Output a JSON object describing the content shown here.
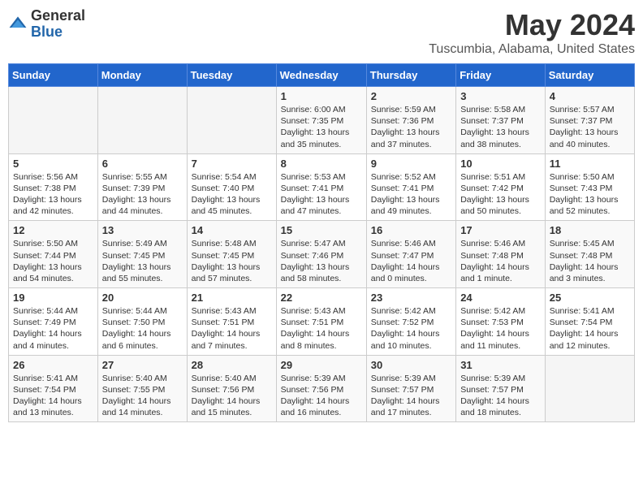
{
  "header": {
    "logo_general": "General",
    "logo_blue": "Blue",
    "month": "May 2024",
    "location": "Tuscumbia, Alabama, United States"
  },
  "weekdays": [
    "Sunday",
    "Monday",
    "Tuesday",
    "Wednesday",
    "Thursday",
    "Friday",
    "Saturday"
  ],
  "weeks": [
    [
      {
        "day": "",
        "detail": ""
      },
      {
        "day": "",
        "detail": ""
      },
      {
        "day": "",
        "detail": ""
      },
      {
        "day": "1",
        "detail": "Sunrise: 6:00 AM\nSunset: 7:35 PM\nDaylight: 13 hours\nand 35 minutes."
      },
      {
        "day": "2",
        "detail": "Sunrise: 5:59 AM\nSunset: 7:36 PM\nDaylight: 13 hours\nand 37 minutes."
      },
      {
        "day": "3",
        "detail": "Sunrise: 5:58 AM\nSunset: 7:37 PM\nDaylight: 13 hours\nand 38 minutes."
      },
      {
        "day": "4",
        "detail": "Sunrise: 5:57 AM\nSunset: 7:37 PM\nDaylight: 13 hours\nand 40 minutes."
      }
    ],
    [
      {
        "day": "5",
        "detail": "Sunrise: 5:56 AM\nSunset: 7:38 PM\nDaylight: 13 hours\nand 42 minutes."
      },
      {
        "day": "6",
        "detail": "Sunrise: 5:55 AM\nSunset: 7:39 PM\nDaylight: 13 hours\nand 44 minutes."
      },
      {
        "day": "7",
        "detail": "Sunrise: 5:54 AM\nSunset: 7:40 PM\nDaylight: 13 hours\nand 45 minutes."
      },
      {
        "day": "8",
        "detail": "Sunrise: 5:53 AM\nSunset: 7:41 PM\nDaylight: 13 hours\nand 47 minutes."
      },
      {
        "day": "9",
        "detail": "Sunrise: 5:52 AM\nSunset: 7:41 PM\nDaylight: 13 hours\nand 49 minutes."
      },
      {
        "day": "10",
        "detail": "Sunrise: 5:51 AM\nSunset: 7:42 PM\nDaylight: 13 hours\nand 50 minutes."
      },
      {
        "day": "11",
        "detail": "Sunrise: 5:50 AM\nSunset: 7:43 PM\nDaylight: 13 hours\nand 52 minutes."
      }
    ],
    [
      {
        "day": "12",
        "detail": "Sunrise: 5:50 AM\nSunset: 7:44 PM\nDaylight: 13 hours\nand 54 minutes."
      },
      {
        "day": "13",
        "detail": "Sunrise: 5:49 AM\nSunset: 7:45 PM\nDaylight: 13 hours\nand 55 minutes."
      },
      {
        "day": "14",
        "detail": "Sunrise: 5:48 AM\nSunset: 7:45 PM\nDaylight: 13 hours\nand 57 minutes."
      },
      {
        "day": "15",
        "detail": "Sunrise: 5:47 AM\nSunset: 7:46 PM\nDaylight: 13 hours\nand 58 minutes."
      },
      {
        "day": "16",
        "detail": "Sunrise: 5:46 AM\nSunset: 7:47 PM\nDaylight: 14 hours\nand 0 minutes."
      },
      {
        "day": "17",
        "detail": "Sunrise: 5:46 AM\nSunset: 7:48 PM\nDaylight: 14 hours\nand 1 minute."
      },
      {
        "day": "18",
        "detail": "Sunrise: 5:45 AM\nSunset: 7:48 PM\nDaylight: 14 hours\nand 3 minutes."
      }
    ],
    [
      {
        "day": "19",
        "detail": "Sunrise: 5:44 AM\nSunset: 7:49 PM\nDaylight: 14 hours\nand 4 minutes."
      },
      {
        "day": "20",
        "detail": "Sunrise: 5:44 AM\nSunset: 7:50 PM\nDaylight: 14 hours\nand 6 minutes."
      },
      {
        "day": "21",
        "detail": "Sunrise: 5:43 AM\nSunset: 7:51 PM\nDaylight: 14 hours\nand 7 minutes."
      },
      {
        "day": "22",
        "detail": "Sunrise: 5:43 AM\nSunset: 7:51 PM\nDaylight: 14 hours\nand 8 minutes."
      },
      {
        "day": "23",
        "detail": "Sunrise: 5:42 AM\nSunset: 7:52 PM\nDaylight: 14 hours\nand 10 minutes."
      },
      {
        "day": "24",
        "detail": "Sunrise: 5:42 AM\nSunset: 7:53 PM\nDaylight: 14 hours\nand 11 minutes."
      },
      {
        "day": "25",
        "detail": "Sunrise: 5:41 AM\nSunset: 7:54 PM\nDaylight: 14 hours\nand 12 minutes."
      }
    ],
    [
      {
        "day": "26",
        "detail": "Sunrise: 5:41 AM\nSunset: 7:54 PM\nDaylight: 14 hours\nand 13 minutes."
      },
      {
        "day": "27",
        "detail": "Sunrise: 5:40 AM\nSunset: 7:55 PM\nDaylight: 14 hours\nand 14 minutes."
      },
      {
        "day": "28",
        "detail": "Sunrise: 5:40 AM\nSunset: 7:56 PM\nDaylight: 14 hours\nand 15 minutes."
      },
      {
        "day": "29",
        "detail": "Sunrise: 5:39 AM\nSunset: 7:56 PM\nDaylight: 14 hours\nand 16 minutes."
      },
      {
        "day": "30",
        "detail": "Sunrise: 5:39 AM\nSunset: 7:57 PM\nDaylight: 14 hours\nand 17 minutes."
      },
      {
        "day": "31",
        "detail": "Sunrise: 5:39 AM\nSunset: 7:57 PM\nDaylight: 14 hours\nand 18 minutes."
      },
      {
        "day": "",
        "detail": ""
      }
    ]
  ]
}
